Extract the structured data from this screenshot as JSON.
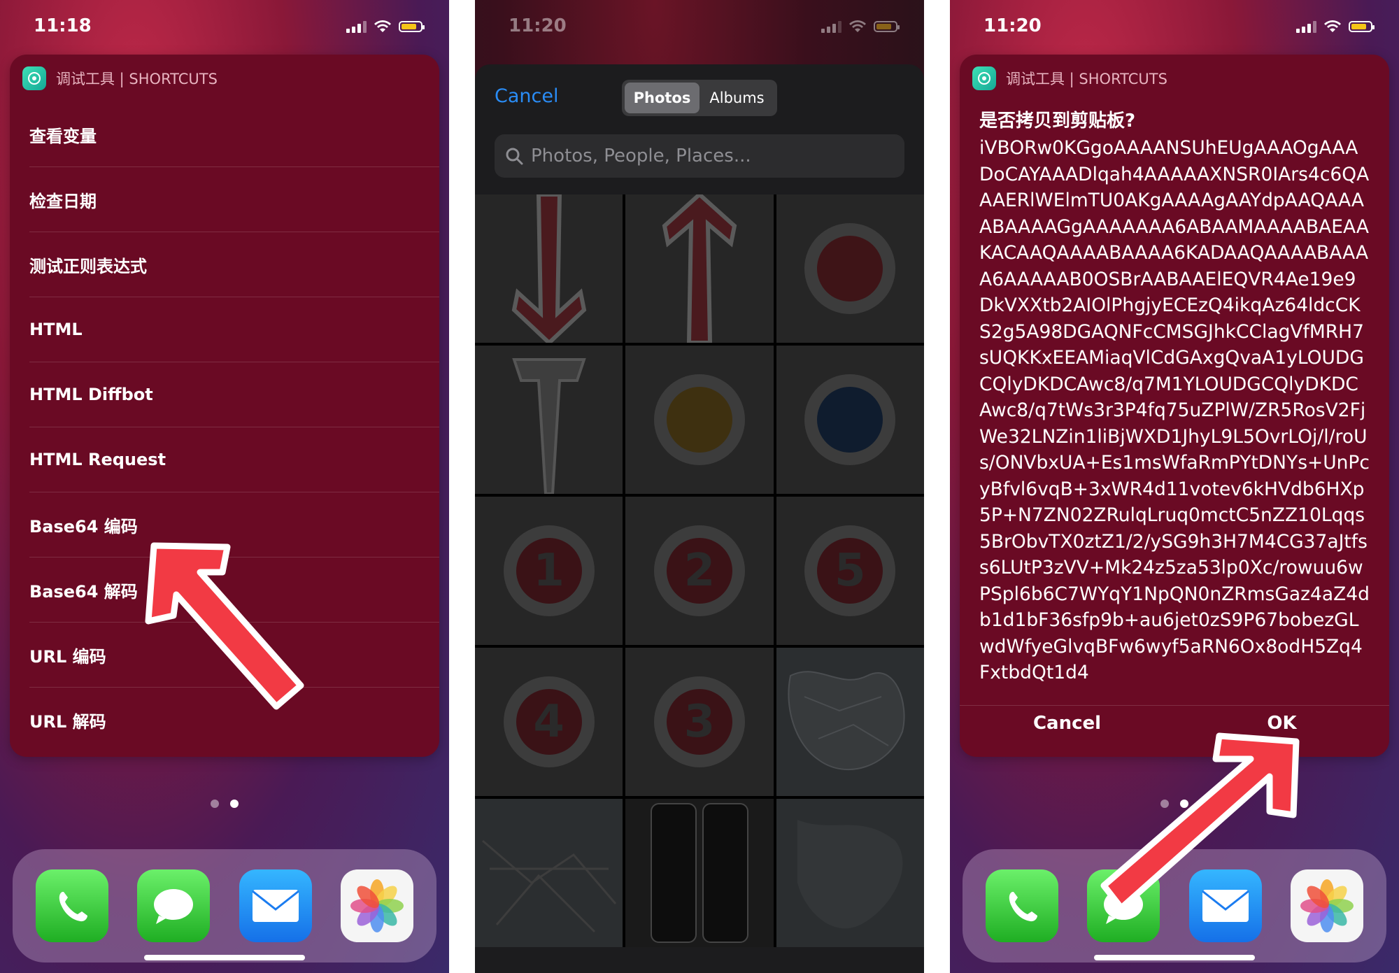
{
  "colors": {
    "arrow_fill": "#f23a44",
    "widget_bg": "#6a0a24",
    "ios_blue": "#2a8cf5"
  },
  "left": {
    "time": "11:18",
    "widget_title": "调试工具 | SHORTCUTS",
    "items": [
      {
        "label": "查看变量"
      },
      {
        "label": "检查日期"
      },
      {
        "label": "测试正则表达式"
      },
      {
        "label": "HTML"
      },
      {
        "label": "HTML Diffbot"
      },
      {
        "label": "HTML Request"
      },
      {
        "label": "Base64 编码"
      },
      {
        "label": "Base64 解码"
      },
      {
        "label": "URL 编码"
      },
      {
        "label": "URL 解码"
      }
    ],
    "page_dots": 2,
    "active_dot": 1,
    "dock": [
      {
        "name": "phone-icon"
      },
      {
        "name": "messages-icon"
      },
      {
        "name": "mail-icon"
      },
      {
        "name": "photos-icon"
      }
    ]
  },
  "middle": {
    "time": "11:20",
    "cancel_label": "Cancel",
    "segments": {
      "photos": "Photos",
      "albums": "Albums"
    },
    "search_placeholder": "Photos, People, Places...",
    "thumb_numbers": [
      "1",
      "2",
      "5",
      "4",
      "3"
    ]
  },
  "right": {
    "time": "11:20",
    "widget_title": "调试工具 | SHORTCUTS",
    "dialog_title": "是否拷贝到剪贴板?",
    "dialog_body": "iVBORw0KGgoAAAANSUhEUgAAAOgAAADoCAYAAADlqah4AAAAAXNSR0IArs4c6QAAAERlWElmTU0AKgAAAAgAAYdpAAQAAAABAAAAGgAAAAAAA6ABAAMAAAABAEAAKACAAQAAAABAAAA6KADAAQAAAABAAAA6AAAAAB0OSBrAABAAElEQVR4Ae19e9DkVXXtb2AIOlPhgjyECEzQ4ikqAz64ldcCKS2g5A98DGAQNFcCMSGJhkCClagVfMRH7sUQKKxEEAMiaqVlCdGAxgQvaA1yLOUDGCQlyDKDCAwc8/q7M1YLOUDGCQlyDKDCAwc8/q7tWs3r3P4fq75uZPlW/ZR5RosV2FjWe32LNZin1liBjWXD1JhyL9L5OvrLOj/l/roUs/ONVbxUA+Es1msWfaRmPYtDNYs+UnPcyBfvl6vqB+3xWR4d11votev6kHVdb6HXp5P+N7ZN02ZRulqLruq0mctC5nZZ10Lqqs5BrObvTX0ztZ1/2/ySG9h3H7M4CG37aJtfss6LUtP3zVV+Mk24z5za53lp0Xc/rowuu6wPSpl6b6C7WYqY1NpQN0nZRmsGaz4aZ4db1d1bF36sfp9b+au6jet0zS9P67bobezGLwdWfyeGlvqBFw6wyf5aRN6Ox8odH5Zq4FxtbdQt1d4",
    "ok_label": "OK",
    "cancel_label": "Cancel"
  }
}
